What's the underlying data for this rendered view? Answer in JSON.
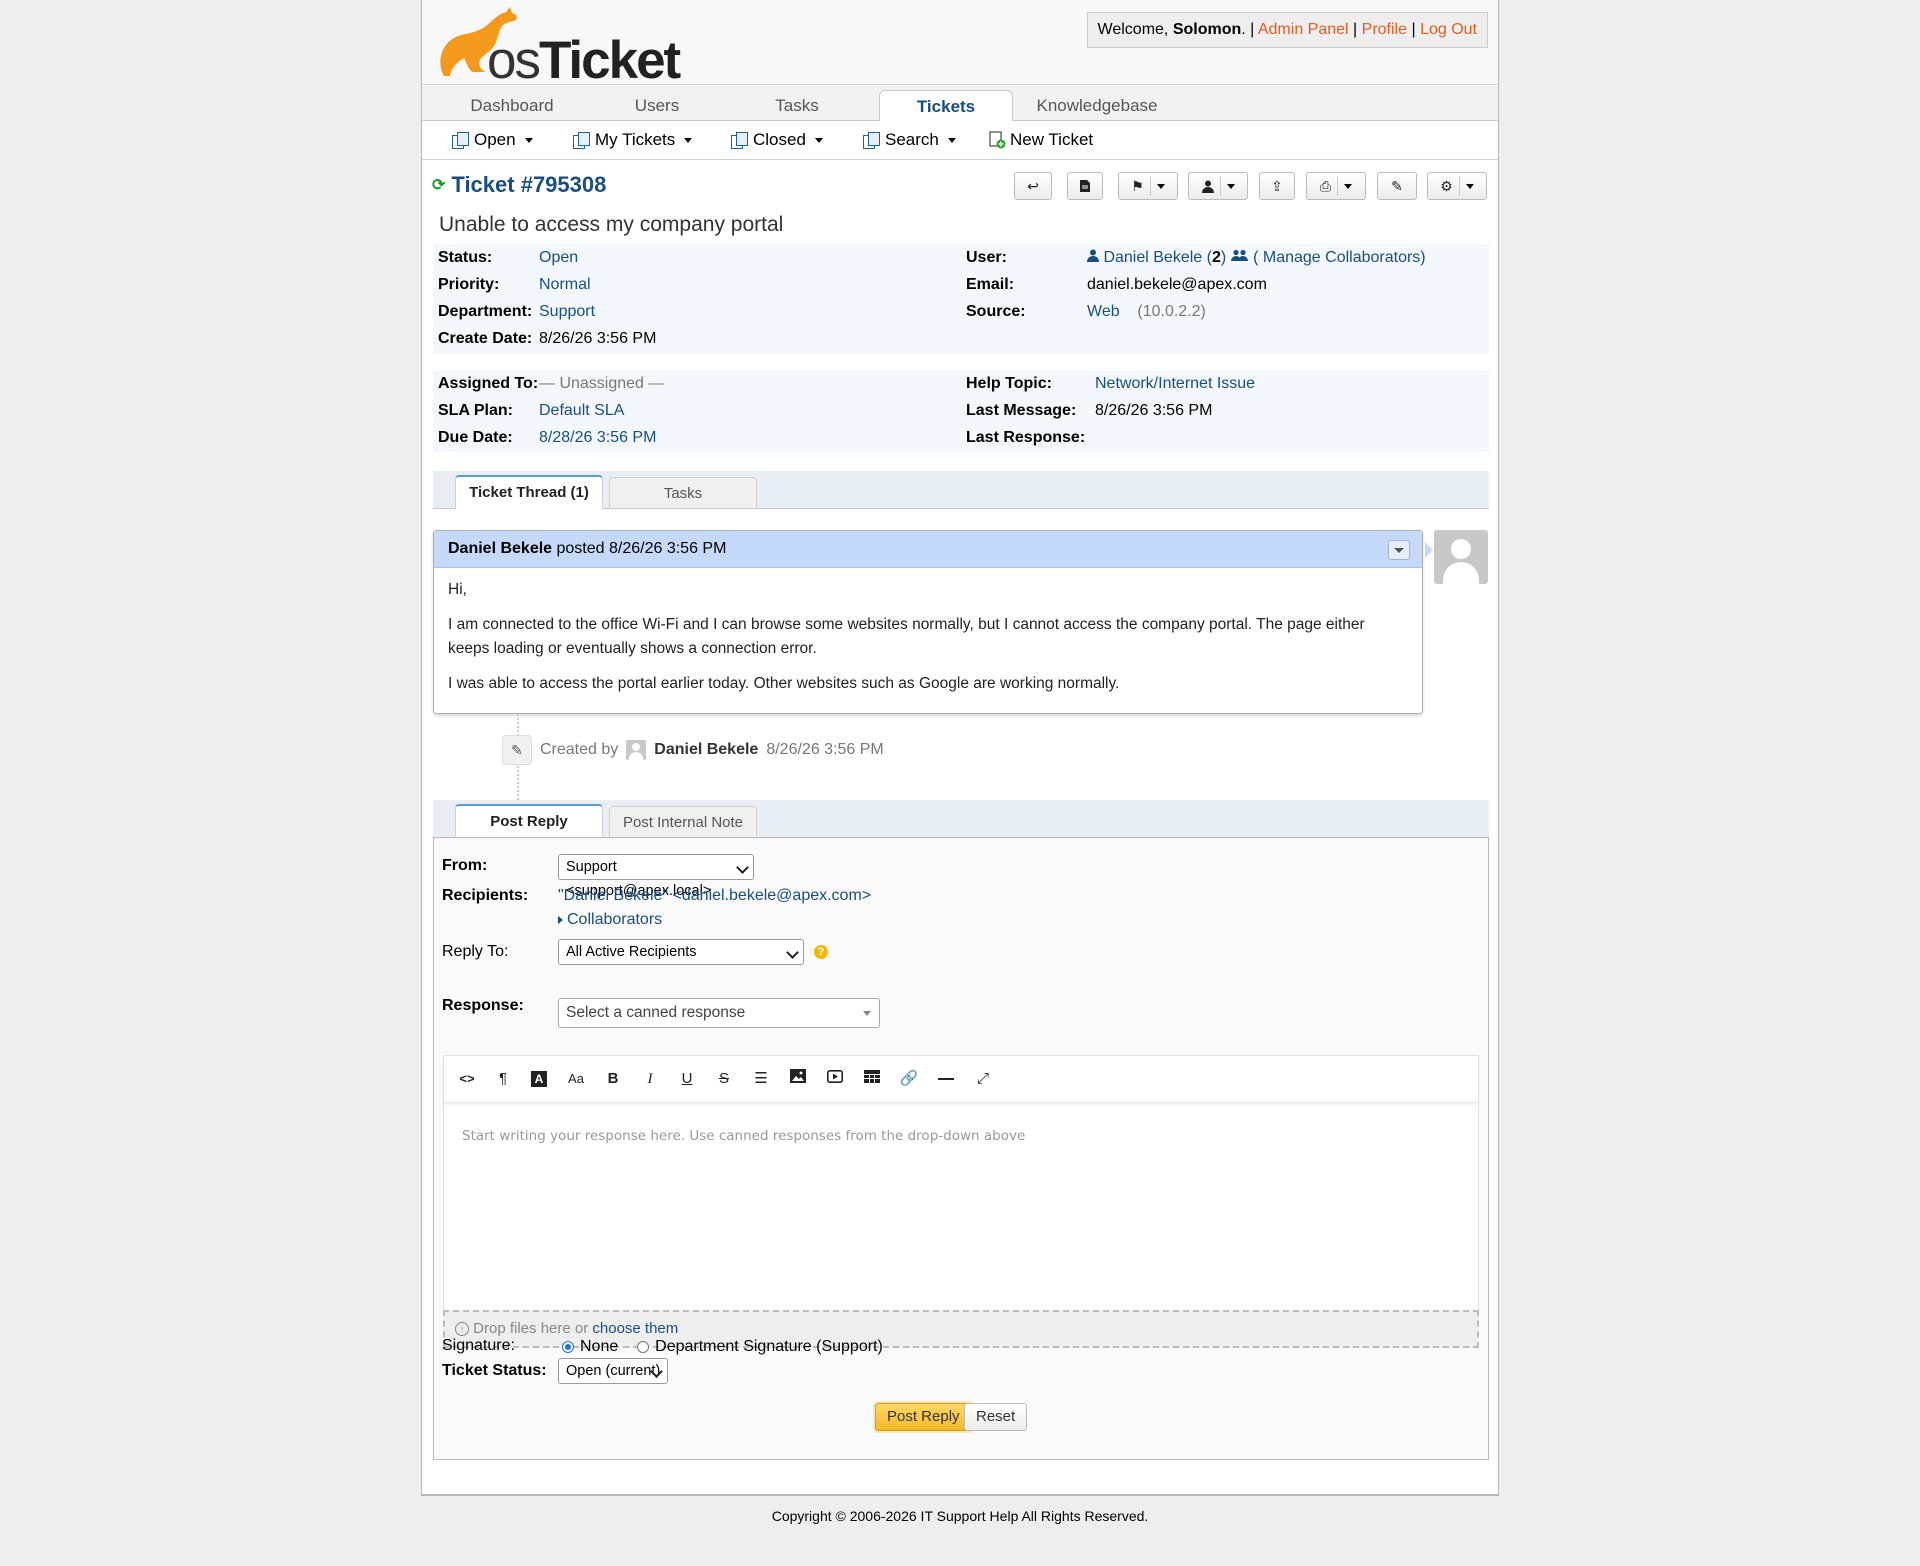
{
  "header": {
    "logo_text_os": "os",
    "logo_text_ticket": "Ticket",
    "welcome_prefix": "Welcome, ",
    "username": "Solomon",
    "welcome_suffix": ". |",
    "admin_panel": "Admin Panel",
    "profile": "Profile",
    "logout": "Log Out",
    "sep": "|"
  },
  "nav": {
    "tabs": [
      "Dashboard",
      "Users",
      "Tasks",
      "Tickets",
      "Knowledgebase"
    ],
    "active": "Tickets"
  },
  "subnav": {
    "open": "Open",
    "my_tickets": "My Tickets",
    "closed": "Closed",
    "search": "Search",
    "new_ticket": "New Ticket"
  },
  "ticket": {
    "title": "Ticket #795308",
    "subject": "Unable to access my company portal",
    "status_label": "Status:",
    "status": "Open",
    "priority_label": "Priority:",
    "priority": "Normal",
    "department_label": "Department:",
    "department": "Support",
    "create_date_label": "Create Date:",
    "create_date": "8/26/26 3:56 PM",
    "user_label": "User:",
    "user_name": "Daniel Bekele",
    "user_count_open": "(",
    "user_count": "2",
    "user_count_close": ")",
    "manage_collab": "( Manage Collaborators)",
    "email_label": "Email:",
    "email": "daniel.bekele@apex.com",
    "source_label": "Source:",
    "source": "Web",
    "source_ip": "(10.0.2.2)",
    "assigned_label": "Assigned To:",
    "assigned": "— Unassigned —",
    "sla_label": "SLA Plan:",
    "sla": "Default SLA",
    "due_label": "Due Date:",
    "due": "8/28/26 3:56 PM",
    "help_topic_label": "Help Topic:",
    "help_topic": "Network/Internet Issue",
    "last_message_label": "Last Message:",
    "last_message": "8/26/26 3:56 PM",
    "last_response_label": "Last Response:",
    "last_response": ""
  },
  "thread_tabs": {
    "thread": "Ticket Thread (1)",
    "tasks": "Tasks"
  },
  "thread": {
    "author": "Daniel Bekele",
    "posted": " posted 8/26/26 3:56 PM",
    "p1": "Hi,",
    "p2": "I am connected to the office Wi-Fi and I can browse some websites normally, but I cannot access the company portal. The page either keeps loading or eventually shows a connection error.",
    "p3": "I was able to access the portal earlier today. Other websites such as Google are working normally."
  },
  "event": {
    "created_by": "Created by",
    "author": "Daniel Bekele",
    "time": "8/26/26 3:56 PM"
  },
  "reply_tabs": {
    "post_reply": "Post Reply",
    "internal_note": "Post Internal Note"
  },
  "reply": {
    "from_label": "From:",
    "from_value": "Support <support@apex.local>",
    "recipients_label": "Recipients:",
    "recipients_value": "\"Daniel Bekele\" <daniel.bekele@apex.com>",
    "collaborators": "Collaborators",
    "reply_to_label": "Reply To:",
    "reply_to_value": "All Active Recipients",
    "response_label": "Response:",
    "response_placeholder": "Select a canned response",
    "editor_placeholder": "Start writing your response here. Use canned responses from the drop-down above",
    "drop_text": "Drop files here or ",
    "choose_them": "choose them",
    "signature_label": "Signature:",
    "sig_none": "None",
    "sig_dept": "Department Signature (Support)",
    "status_label": "Ticket Status:",
    "status_value": "Open (current)",
    "post_button": "Post Reply",
    "reset_button": "Reset"
  },
  "toolbar_icons": [
    "code-icon",
    "paragraph-icon",
    "text-color-icon",
    "font-size-icon",
    "bold-icon",
    "italic-icon",
    "underline-icon",
    "strikethrough-icon",
    "list-icon",
    "image-icon",
    "video-icon",
    "table-icon",
    "link-icon",
    "horizontal-rule-icon",
    "fullscreen-icon"
  ],
  "footer": "Copyright © 2006-2026 IT Support Help All Rights Reserved.",
  "colors": {
    "accent": "#184e81",
    "orange": "#e25c22",
    "thread_header": "#c5dafa",
    "post_button": "#f5b926"
  }
}
